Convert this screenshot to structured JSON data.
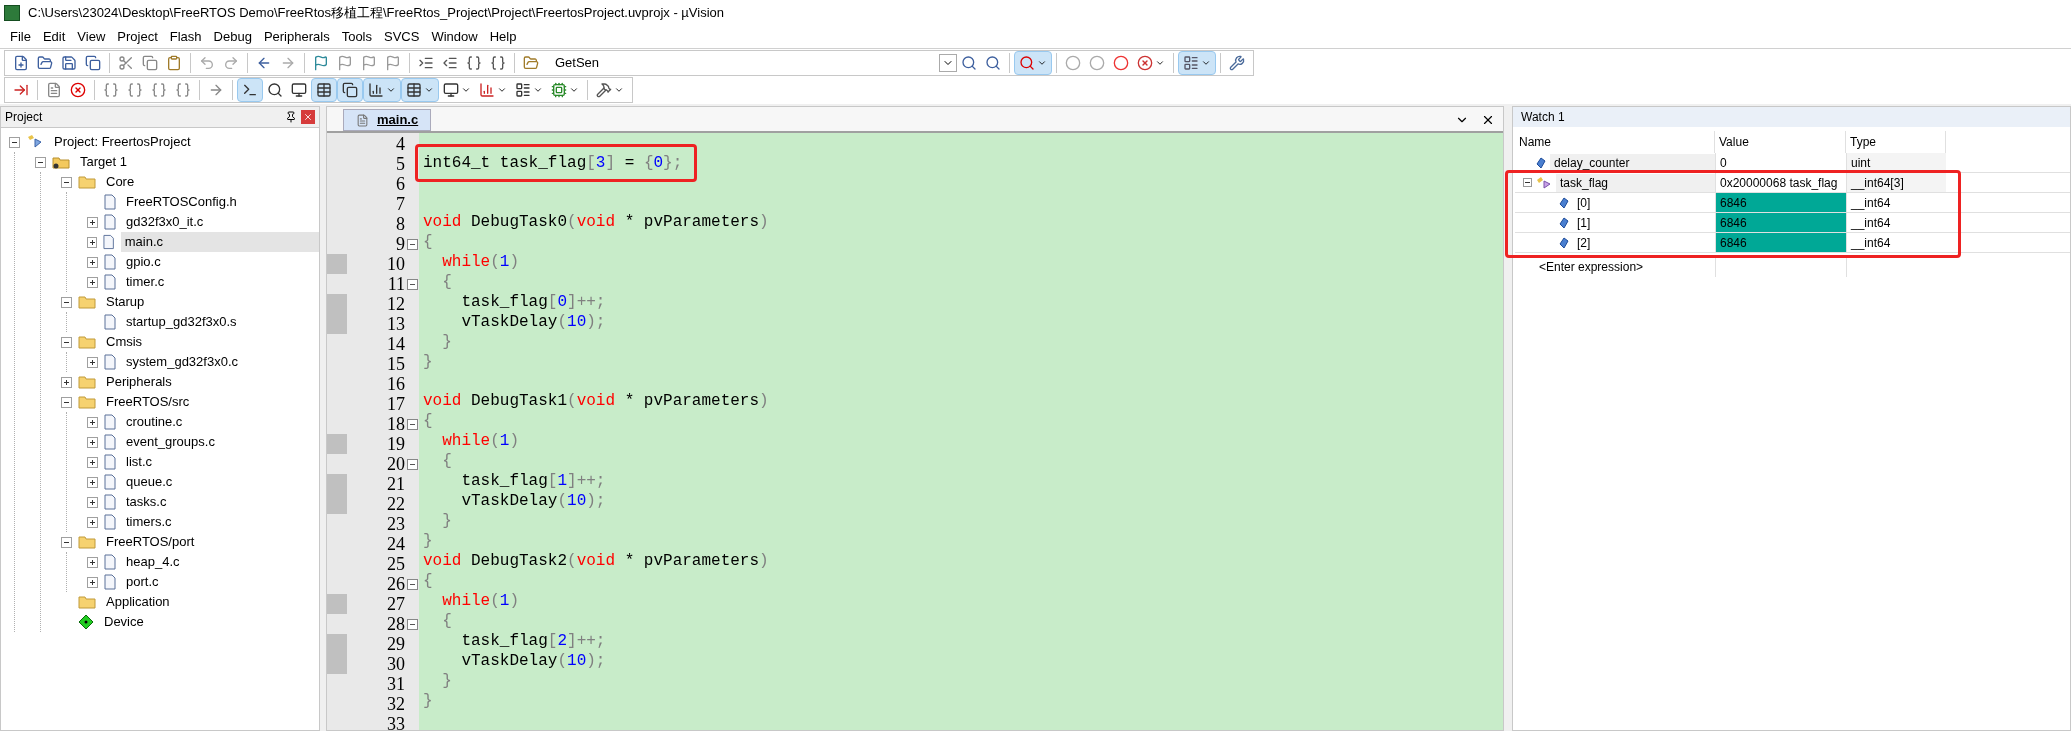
{
  "window": {
    "title": "C:\\Users\\23024\\Desktop\\FreeRTOS Demo\\FreeRtos移植工程\\FreeRtos_Project\\Project\\FreertosProject.uvprojx - µVision"
  },
  "menu": [
    "File",
    "Edit",
    "View",
    "Project",
    "Flash",
    "Debug",
    "Peripherals",
    "Tools",
    "SVCS",
    "Window",
    "Help"
  ],
  "toolbar": {
    "find_value": "GetSen"
  },
  "project_panel": {
    "title": "Project",
    "tree": [
      {
        "label": "Project: FreertosProject",
        "kind": "project",
        "expanded": true,
        "selected": false,
        "children": [
          {
            "label": "Target 1",
            "kind": "target",
            "expanded": true,
            "selected": false,
            "children": [
              {
                "label": "Core",
                "kind": "folder",
                "expanded": true,
                "selected": false,
                "children": [
                  {
                    "label": "FreeRTOSConfig.h",
                    "kind": "file",
                    "selected": false
                  },
                  {
                    "label": "gd32f3x0_it.c",
                    "kind": "file",
                    "expanded": false,
                    "selected": false
                  },
                  {
                    "label": "main.c",
                    "kind": "file",
                    "expanded": false,
                    "selected": true
                  },
                  {
                    "label": "gpio.c",
                    "kind": "file",
                    "expanded": false,
                    "selected": false
                  },
                  {
                    "label": "timer.c",
                    "kind": "file",
                    "expanded": false,
                    "selected": false
                  }
                ]
              },
              {
                "label": "Starup",
                "kind": "folder",
                "expanded": true,
                "selected": false,
                "children": [
                  {
                    "label": "startup_gd32f3x0.s",
                    "kind": "file",
                    "selected": false
                  }
                ]
              },
              {
                "label": "Cmsis",
                "kind": "folder",
                "expanded": true,
                "selected": false,
                "children": [
                  {
                    "label": "system_gd32f3x0.c",
                    "kind": "file",
                    "expanded": false,
                    "selected": false
                  }
                ]
              },
              {
                "label": "Peripherals",
                "kind": "folder",
                "expanded": false,
                "selected": false
              },
              {
                "label": "FreeRTOS/src",
                "kind": "folder",
                "expanded": true,
                "selected": false,
                "children": [
                  {
                    "label": "croutine.c",
                    "kind": "file",
                    "expanded": false,
                    "selected": false
                  },
                  {
                    "label": "event_groups.c",
                    "kind": "file",
                    "expanded": false,
                    "selected": false
                  },
                  {
                    "label": "list.c",
                    "kind": "file",
                    "expanded": false,
                    "selected": false
                  },
                  {
                    "label": "queue.c",
                    "kind": "file",
                    "expanded": false,
                    "selected": false
                  },
                  {
                    "label": "tasks.c",
                    "kind": "file",
                    "expanded": false,
                    "selected": false
                  },
                  {
                    "label": "timers.c",
                    "kind": "file",
                    "expanded": false,
                    "selected": false
                  }
                ]
              },
              {
                "label": "FreeRTOS/port",
                "kind": "folder",
                "expanded": true,
                "selected": false,
                "children": [
                  {
                    "label": "heap_4.c",
                    "kind": "file",
                    "expanded": false,
                    "selected": false
                  },
                  {
                    "label": "port.c",
                    "kind": "file",
                    "expanded": false,
                    "selected": false
                  }
                ]
              },
              {
                "label": "Application",
                "kind": "folder",
                "selected": false
              },
              {
                "label": "Device",
                "kind": "device",
                "selected": false
              }
            ]
          }
        ]
      }
    ]
  },
  "editor": {
    "tabs": [
      {
        "label": "main.c",
        "selected": true
      }
    ],
    "lines": [
      {
        "number": "4",
        "executable": false,
        "fold_box": false,
        "outlined": false
      },
      {
        "number": "5",
        "executable": false,
        "fold_box": false,
        "outlined": true,
        "tokens": [
          {
            "kind": "plain",
            "text": "int64_t task_flag"
          },
          {
            "kind": "punct",
            "text": "["
          },
          {
            "kind": "number",
            "text": "3"
          },
          {
            "kind": "punct",
            "text": "]"
          },
          {
            "kind": "plain",
            "text": " = "
          },
          {
            "kind": "punct",
            "text": "{"
          },
          {
            "kind": "number",
            "text": "0"
          },
          {
            "kind": "punct",
            "text": "};"
          }
        ]
      },
      {
        "number": "6",
        "executable": false,
        "fold_box": false,
        "outlined": false
      },
      {
        "number": "7",
        "executable": false,
        "fold_box": false,
        "outlined": false
      },
      {
        "number": "8",
        "executable": false,
        "fold_box": false,
        "outlined": false,
        "tokens": [
          {
            "kind": "keyword",
            "text": "void"
          },
          {
            "kind": "plain",
            "text": " DebugTask0"
          },
          {
            "kind": "punct",
            "text": "("
          },
          {
            "kind": "keyword",
            "text": "void"
          },
          {
            "kind": "plain",
            "text": " * pvParameters"
          },
          {
            "kind": "punct",
            "text": ")"
          }
        ]
      },
      {
        "number": "9",
        "executable": false,
        "fold_box": true,
        "outlined": false,
        "tokens": [
          {
            "kind": "punct",
            "text": "{"
          }
        ]
      },
      {
        "number": "10",
        "executable": true,
        "fold_box": false,
        "outlined": false,
        "tokens": [
          {
            "kind": "keyword",
            "text": "  while"
          },
          {
            "kind": "punct",
            "text": "("
          },
          {
            "kind": "number",
            "text": "1"
          },
          {
            "kind": "punct",
            "text": ")"
          }
        ]
      },
      {
        "number": "11",
        "executable": false,
        "fold_box": true,
        "outlined": false,
        "tokens": [
          {
            "kind": "punct",
            "text": "  {"
          }
        ]
      },
      {
        "number": "12",
        "executable": true,
        "fold_box": false,
        "outlined": false,
        "tokens": [
          {
            "kind": "plain",
            "text": "    task_flag"
          },
          {
            "kind": "punct",
            "text": "["
          },
          {
            "kind": "number",
            "text": "0"
          },
          {
            "kind": "punct",
            "text": "]++;"
          }
        ]
      },
      {
        "number": "13",
        "executable": true,
        "fold_box": false,
        "outlined": false,
        "tokens": [
          {
            "kind": "plain",
            "text": "    vTaskDelay"
          },
          {
            "kind": "punct",
            "text": "("
          },
          {
            "kind": "number",
            "text": "10"
          },
          {
            "kind": "punct",
            "text": ");"
          }
        ]
      },
      {
        "number": "14",
        "executable": false,
        "fold_box": false,
        "outlined": false,
        "tokens": [
          {
            "kind": "punct",
            "text": "  }"
          }
        ]
      },
      {
        "number": "15",
        "executable": false,
        "fold_box": false,
        "outlined": false,
        "tokens": [
          {
            "kind": "punct",
            "text": "}"
          }
        ]
      },
      {
        "number": "16",
        "executable": false,
        "fold_box": false,
        "outlined": false
      },
      {
        "number": "17",
        "executable": false,
        "fold_box": false,
        "outlined": false,
        "tokens": [
          {
            "kind": "keyword",
            "text": "void"
          },
          {
            "kind": "plain",
            "text": " DebugTask1"
          },
          {
            "kind": "punct",
            "text": "("
          },
          {
            "kind": "keyword",
            "text": "void"
          },
          {
            "kind": "plain",
            "text": " * pvParameters"
          },
          {
            "kind": "punct",
            "text": ")"
          }
        ]
      },
      {
        "number": "18",
        "executable": false,
        "fold_box": true,
        "outlined": false,
        "tokens": [
          {
            "kind": "punct",
            "text": "{"
          }
        ]
      },
      {
        "number": "19",
        "executable": true,
        "fold_box": false,
        "outlined": false,
        "tokens": [
          {
            "kind": "keyword",
            "text": "  while"
          },
          {
            "kind": "punct",
            "text": "("
          },
          {
            "kind": "number",
            "text": "1"
          },
          {
            "kind": "punct",
            "text": ")"
          }
        ]
      },
      {
        "number": "20",
        "executable": false,
        "fold_box": true,
        "outlined": false,
        "tokens": [
          {
            "kind": "punct",
            "text": "  {"
          }
        ]
      },
      {
        "number": "21",
        "executable": true,
        "fold_box": false,
        "outlined": false,
        "tokens": [
          {
            "kind": "plain",
            "text": "    task_flag"
          },
          {
            "kind": "punct",
            "text": "["
          },
          {
            "kind": "number",
            "text": "1"
          },
          {
            "kind": "punct",
            "text": "]++;"
          }
        ]
      },
      {
        "number": "22",
        "executable": true,
        "fold_box": false,
        "outlined": false,
        "tokens": [
          {
            "kind": "plain",
            "text": "    vTaskDelay"
          },
          {
            "kind": "punct",
            "text": "("
          },
          {
            "kind": "number",
            "text": "10"
          },
          {
            "kind": "punct",
            "text": ");"
          }
        ]
      },
      {
        "number": "23",
        "executable": false,
        "fold_box": false,
        "outlined": false,
        "tokens": [
          {
            "kind": "punct",
            "text": "  }"
          }
        ]
      },
      {
        "number": "24",
        "executable": false,
        "fold_box": false,
        "outlined": false,
        "tokens": [
          {
            "kind": "punct",
            "text": "}"
          }
        ]
      },
      {
        "number": "25",
        "executable": false,
        "fold_box": false,
        "outlined": false,
        "tokens": [
          {
            "kind": "keyword",
            "text": "void"
          },
          {
            "kind": "plain",
            "text": " DebugTask2"
          },
          {
            "kind": "punct",
            "text": "("
          },
          {
            "kind": "keyword",
            "text": "void"
          },
          {
            "kind": "plain",
            "text": " * pvParameters"
          },
          {
            "kind": "punct",
            "text": ")"
          }
        ]
      },
      {
        "number": "26",
        "executable": false,
        "fold_box": true,
        "outlined": false,
        "tokens": [
          {
            "kind": "punct",
            "text": "{"
          }
        ]
      },
      {
        "number": "27",
        "executable": true,
        "fold_box": false,
        "outlined": false,
        "tokens": [
          {
            "kind": "keyword",
            "text": "  while"
          },
          {
            "kind": "punct",
            "text": "("
          },
          {
            "kind": "number",
            "text": "1"
          },
          {
            "kind": "punct",
            "text": ")"
          }
        ]
      },
      {
        "number": "28",
        "executable": false,
        "fold_box": true,
        "outlined": false,
        "tokens": [
          {
            "kind": "punct",
            "text": "  {"
          }
        ]
      },
      {
        "number": "29",
        "executable": true,
        "fold_box": false,
        "outlined": false,
        "tokens": [
          {
            "kind": "plain",
            "text": "    task_flag"
          },
          {
            "kind": "punct",
            "text": "["
          },
          {
            "kind": "number",
            "text": "2"
          },
          {
            "kind": "punct",
            "text": "]++;"
          }
        ]
      },
      {
        "number": "30",
        "executable": true,
        "fold_box": false,
        "outlined": false,
        "tokens": [
          {
            "kind": "plain",
            "text": "    vTaskDelay"
          },
          {
            "kind": "punct",
            "text": "("
          },
          {
            "kind": "number",
            "text": "10"
          },
          {
            "kind": "punct",
            "text": ");"
          }
        ]
      },
      {
        "number": "31",
        "executable": false,
        "fold_box": false,
        "outlined": false,
        "tokens": [
          {
            "kind": "punct",
            "text": "  }"
          }
        ]
      },
      {
        "number": "32",
        "executable": false,
        "fold_box": false,
        "outlined": false,
        "tokens": [
          {
            "kind": "punct",
            "text": "}"
          }
        ]
      },
      {
        "number": "33",
        "executable": false,
        "fold_box": false,
        "outlined": false
      }
    ]
  },
  "watch": {
    "title": "Watch 1",
    "columns": [
      "Name",
      "Value",
      "Type"
    ],
    "rows": [
      {
        "name": "delay_counter",
        "value": "0",
        "type": "uint",
        "kind": "variable",
        "changed": false,
        "outlined": false
      },
      {
        "name": "task_flag",
        "value": "0x20000068 task_flag",
        "type": "__int64[3]",
        "kind": "array",
        "changed": false,
        "expanded": true,
        "outlined": true,
        "children": [
          {
            "name": "[0]",
            "value": "6846",
            "type": "__int64",
            "kind": "variable",
            "changed": true
          },
          {
            "name": "[1]",
            "value": "6846",
            "type": "__int64",
            "kind": "variable",
            "changed": true
          },
          {
            "name": "[2]",
            "value": "6846",
            "type": "__int64",
            "kind": "variable",
            "changed": true
          }
        ]
      }
    ],
    "placeholder": "<Enter expression>"
  }
}
